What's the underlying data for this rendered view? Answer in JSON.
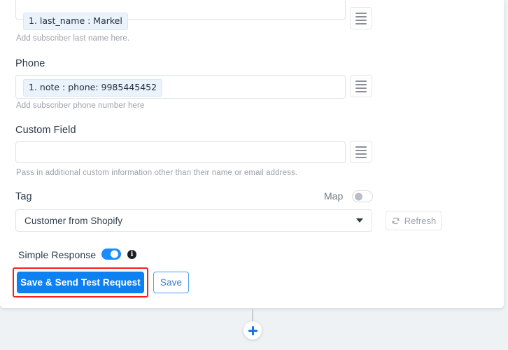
{
  "form": {
    "last_name": {
      "chip_text": "1. last_name : Markel",
      "help": "Add subscriber last name here.",
      "handle_icon": "list-handle-icon"
    },
    "phone": {
      "label": "Phone",
      "chip_text": "1. note : phone: 9985445452",
      "help": "Add subscriber phone number here",
      "handle_icon": "list-handle-icon"
    },
    "custom_field": {
      "label": "Custom Field",
      "value": "",
      "help": "Pass in additional custom information other than their name or email address.",
      "handle_icon": "list-handle-icon"
    },
    "tag": {
      "label": "Tag",
      "selected": "Customer from Shopify",
      "caret_icon": "chevron-down-icon"
    },
    "map": {
      "label": "Map",
      "state": "off"
    },
    "refresh": {
      "label": "Refresh",
      "icon": "refresh-icon"
    },
    "simple_response": {
      "label": "Simple Response",
      "state": "on",
      "info_icon": "info-icon",
      "info_glyph": "i"
    }
  },
  "actions": {
    "primary_label": "Save & Send Test Request",
    "secondary_label": "Save"
  },
  "flow": {
    "add_node_icon": "plus-icon"
  },
  "colors": {
    "accent_blue": "#0d80f2",
    "toggle_on": "#1a8cff",
    "highlight_red": "#fc1d1d",
    "chip_bg": "#eaf2fc",
    "canvas_bg": "#eef2f5"
  }
}
